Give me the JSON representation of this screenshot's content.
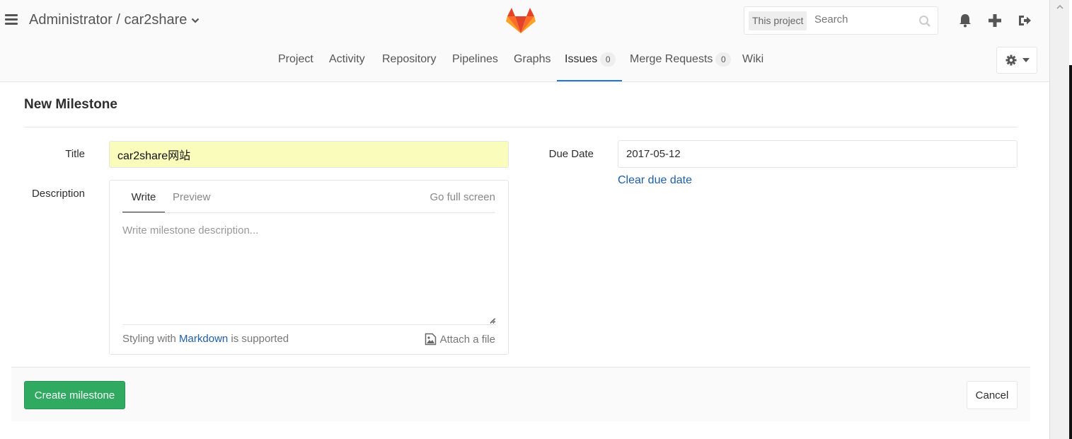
{
  "header": {
    "breadcrumb": "Administrator / car2share",
    "search": {
      "scope": "This project",
      "placeholder": "Search"
    },
    "icons": [
      "bell-icon",
      "plus-icon",
      "sign-out-icon"
    ]
  },
  "nav": {
    "items": [
      {
        "label": "Project"
      },
      {
        "label": "Activity"
      },
      {
        "label": "Repository"
      },
      {
        "label": "Pipelines"
      },
      {
        "label": "Graphs"
      },
      {
        "label": "Issues",
        "count": "0",
        "active": true
      },
      {
        "label": "Merge Requests",
        "count": "0"
      },
      {
        "label": "Wiki"
      }
    ]
  },
  "form": {
    "page_title": "New Milestone",
    "title_label": "Title",
    "title_value": "car2share网站",
    "description_label": "Description",
    "tab_write": "Write",
    "tab_preview": "Preview",
    "full_screen": "Go full screen",
    "description_placeholder": "Write milestone description...",
    "styling_prefix": "Styling with",
    "markdown_link": "Markdown",
    "styling_suffix": "is supported",
    "attach_file": "Attach a file",
    "due_date_label": "Due Date",
    "due_date_value": "2017-05-12",
    "clear_due_date": "Clear due date"
  },
  "actions": {
    "create": "Create milestone",
    "cancel": "Cancel"
  },
  "colors": {
    "primary_green": "#2faa60",
    "link_blue": "#1f5ea8",
    "active_tab_border": "#1f78d1",
    "title_input_bg": "#fafcbc",
    "logo_orange": "#e24329"
  }
}
